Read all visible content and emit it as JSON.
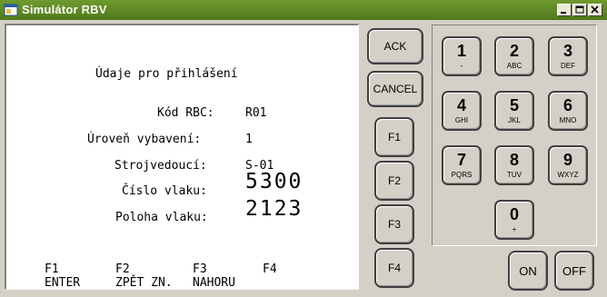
{
  "window": {
    "title": "Simulátor RBV"
  },
  "screen": {
    "heading": "Údaje pro přihlášení",
    "rows": [
      {
        "label": "Kód RBC:",
        "value": "R01"
      },
      {
        "label": "Úroveň vybavení:",
        "value": "1"
      },
      {
        "label": "Strojvedoucí:",
        "value": "S-01"
      },
      {
        "label": "Číslo vlaku:",
        "value": "5300"
      },
      {
        "label": "Poloha vlaku:",
        "value": "2123"
      }
    ],
    "softkeys": [
      {
        "key": "F1",
        "action": "ENTER"
      },
      {
        "key": "F2",
        "action": "ZPĚT ZN."
      },
      {
        "key": "F3",
        "action": "NAHORU"
      },
      {
        "key": "F4",
        "action": ""
      }
    ]
  },
  "buttons": {
    "ack": "ACK",
    "cancel": "CANCEL",
    "f1": "F1",
    "f2": "F2",
    "f3": "F3",
    "f4": "F4",
    "on": "ON",
    "off": "OFF"
  },
  "keypad": [
    {
      "digit": "1",
      "sub": "-"
    },
    {
      "digit": "2",
      "sub": "ABC"
    },
    {
      "digit": "3",
      "sub": "DEF"
    },
    {
      "digit": "4",
      "sub": "GHI"
    },
    {
      "digit": "5",
      "sub": "JKL"
    },
    {
      "digit": "6",
      "sub": "MNO"
    },
    {
      "digit": "7",
      "sub": "PQRS"
    },
    {
      "digit": "8",
      "sub": "TUV"
    },
    {
      "digit": "9",
      "sub": "WXYZ"
    },
    {
      "digit": "0",
      "sub": "+"
    }
  ],
  "colors": {
    "titlebar": "#5a8a24",
    "face": "#d4d0c8"
  }
}
